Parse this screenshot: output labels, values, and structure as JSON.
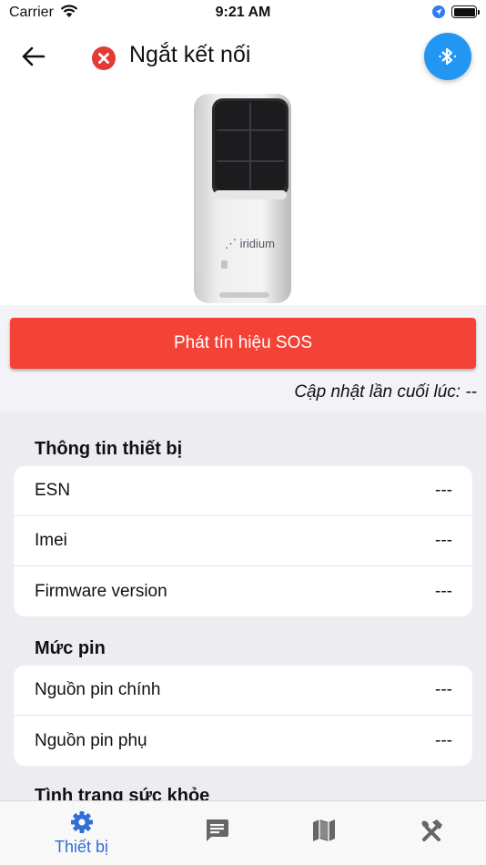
{
  "status_bar": {
    "carrier": "Carrier",
    "time": "9:21 AM"
  },
  "header": {
    "title": "Ngắt kết nối",
    "device_brand": "iridium"
  },
  "sos": {
    "label": "Phát tín hiệu SOS"
  },
  "last_update": {
    "text": "Cập nhật lần cuối lúc: --"
  },
  "device_info": {
    "title": "Thông tin thiết bị",
    "rows": [
      {
        "label": "ESN",
        "value": "---"
      },
      {
        "label": "Imei",
        "value": "---"
      },
      {
        "label": "Firmware version",
        "value": "---"
      }
    ]
  },
  "battery": {
    "title": "Mức pin",
    "rows": [
      {
        "label": "Nguồn pin chính",
        "value": "---"
      },
      {
        "label": "Nguồn pin phụ",
        "value": "---"
      }
    ]
  },
  "health": {
    "title": "Tình trạng sức khỏe"
  },
  "tabbar": {
    "tabs": [
      {
        "label": "Thiết bị",
        "icon": "gear-icon",
        "active": true
      },
      {
        "label": "",
        "icon": "message-icon",
        "active": false
      },
      {
        "label": "",
        "icon": "map-icon",
        "active": false
      },
      {
        "label": "",
        "icon": "tools-icon",
        "active": false
      }
    ]
  },
  "colors": {
    "accent": "#2196f3",
    "sos": "#f44336",
    "danger": "#e53935",
    "tab_active": "#2f6fd6",
    "tab_inactive": "#666666"
  }
}
